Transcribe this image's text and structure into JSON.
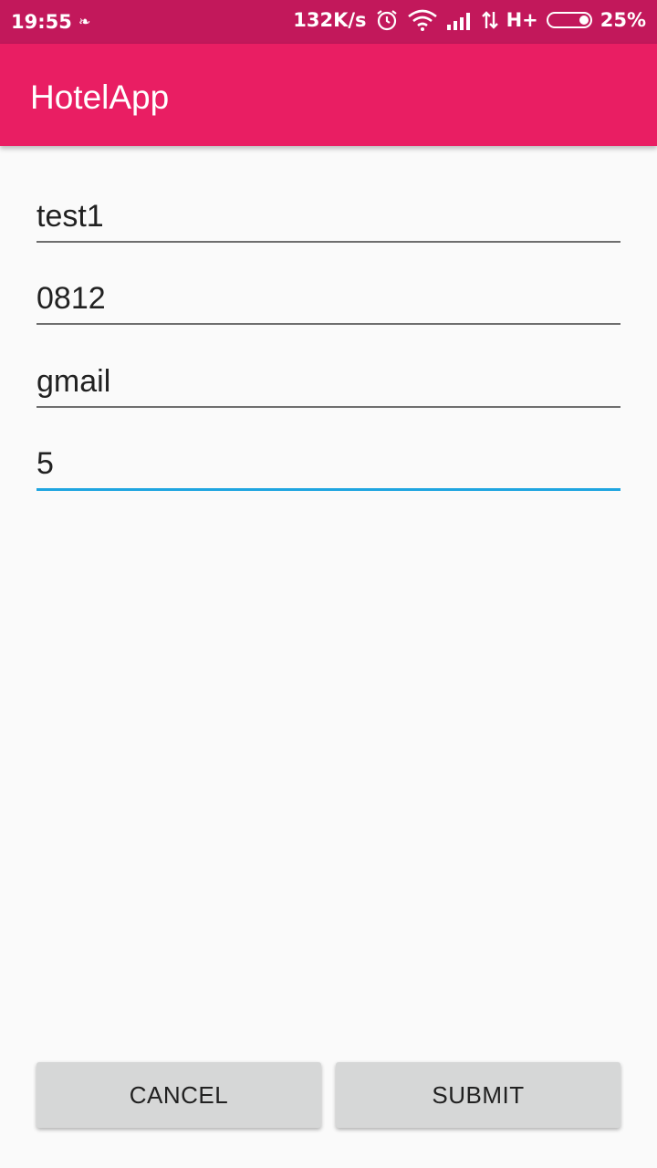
{
  "status_bar": {
    "time": "19:55",
    "speed": "132K/s",
    "network": "H+",
    "battery": "25%"
  },
  "app_bar": {
    "title": "HotelApp"
  },
  "form": {
    "fields": [
      {
        "value": "test1"
      },
      {
        "value": "0812"
      },
      {
        "value": "gmail"
      },
      {
        "value": "5"
      }
    ],
    "active_index": 3
  },
  "buttons": {
    "cancel": "CANCEL",
    "submit": "SUBMIT"
  },
  "colors": {
    "status_bar": "#c2185b",
    "app_bar": "#e91e63",
    "focus_underline": "#1ea5e0"
  }
}
